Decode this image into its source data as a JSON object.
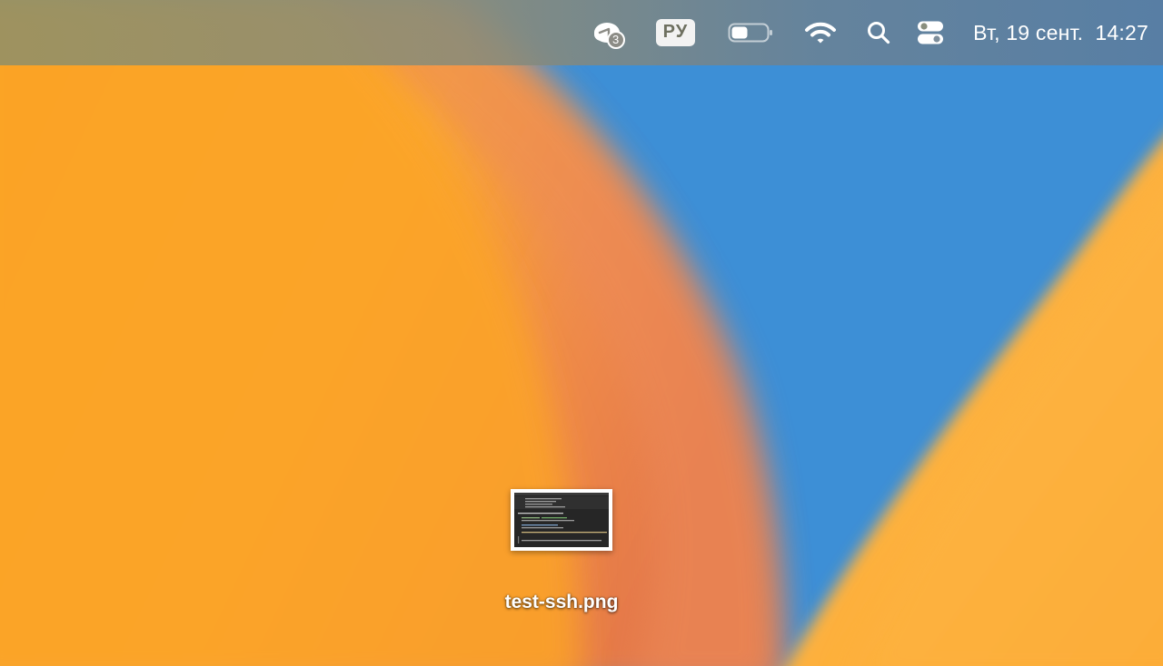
{
  "menubar": {
    "cloud_badge_count": "3",
    "keyboard_layout": "РУ",
    "datetime": "Вт, 19 сент.  14:27",
    "battery_level": 0.45,
    "icons": [
      "cloud-sync-icon",
      "keyboard-layout-indicator",
      "battery-icon",
      "wifi-icon",
      "search-icon",
      "control-center-icon"
    ]
  },
  "desktop": {
    "files": [
      {
        "name": "test-ssh.png",
        "icon": "image-thumbnail"
      }
    ]
  },
  "colors": {
    "wallpaper_orange": "#fba21e",
    "wallpaper_blue": "#3d8fd6",
    "menubar_text": "#ffffff"
  }
}
